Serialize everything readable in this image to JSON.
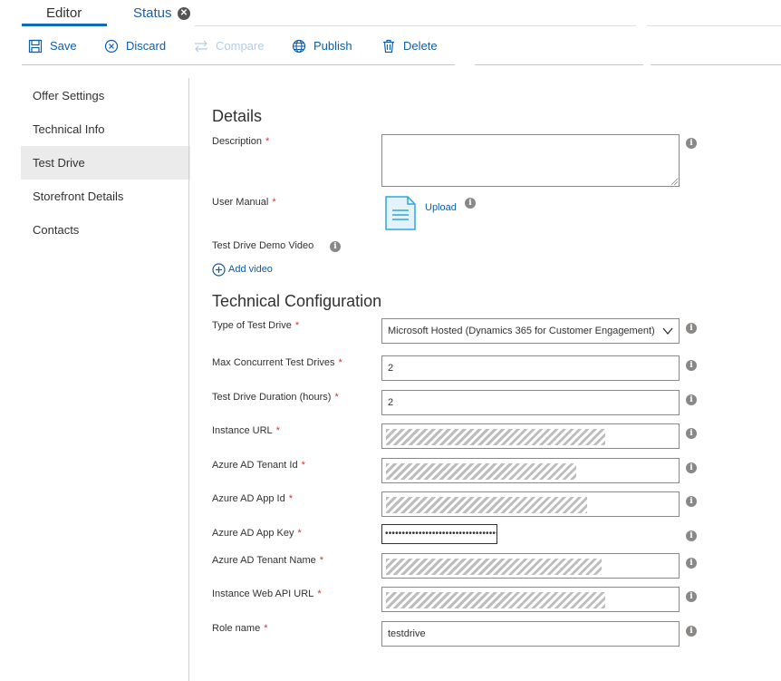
{
  "tabs": {
    "editor": "Editor",
    "status": "Status",
    "close_glyph": "✕"
  },
  "toolbar": {
    "save": "Save",
    "discard": "Discard",
    "compare": "Compare",
    "publish": "Publish",
    "delete": "Delete"
  },
  "nav": {
    "items": [
      "Offer Settings",
      "Technical Info",
      "Test Drive",
      "Storefront Details",
      "Contacts"
    ],
    "active": "Test Drive"
  },
  "details": {
    "title": "Details",
    "description_label": "Description",
    "user_manual_label": "User Manual",
    "upload_label": "Upload",
    "demo_video_label": "Test Drive Demo Video",
    "add_video_label": "Add video"
  },
  "tech": {
    "title": "Technical Configuration",
    "type_label": "Type of Test Drive",
    "type_value": "Microsoft Hosted (Dynamics 365 for Customer Engagement)",
    "max_label": "Max Concurrent Test Drives",
    "max_value": "2",
    "duration_label": "Test Drive Duration (hours)",
    "duration_value": "2",
    "instance_url_label": "Instance URL",
    "tenant_id_label": "Azure AD Tenant Id",
    "app_id_label": "Azure AD App Id",
    "app_key_label": "Azure AD App Key",
    "app_key_value": "••••••••••••••••••••••••••••••••••",
    "tenant_name_label": "Azure AD Tenant Name",
    "web_api_label": "Instance Web API URL",
    "role_label": "Role name",
    "role_value": "testdrive"
  },
  "required_mark": "*",
  "info_glyph": "i",
  "icons": {
    "save": "save-icon",
    "discard": "discard-icon",
    "compare": "compare-icon",
    "publish": "publish-icon",
    "delete": "delete-icon",
    "document": "document-icon",
    "add": "add-circle-icon",
    "info": "info-icon",
    "chevron": "chevron-down-icon"
  },
  "colors": {
    "accent": "#0f6cbd",
    "link": "#0f5ea8",
    "required": "#d13438",
    "nav_active_bg": "#ebebeb"
  }
}
